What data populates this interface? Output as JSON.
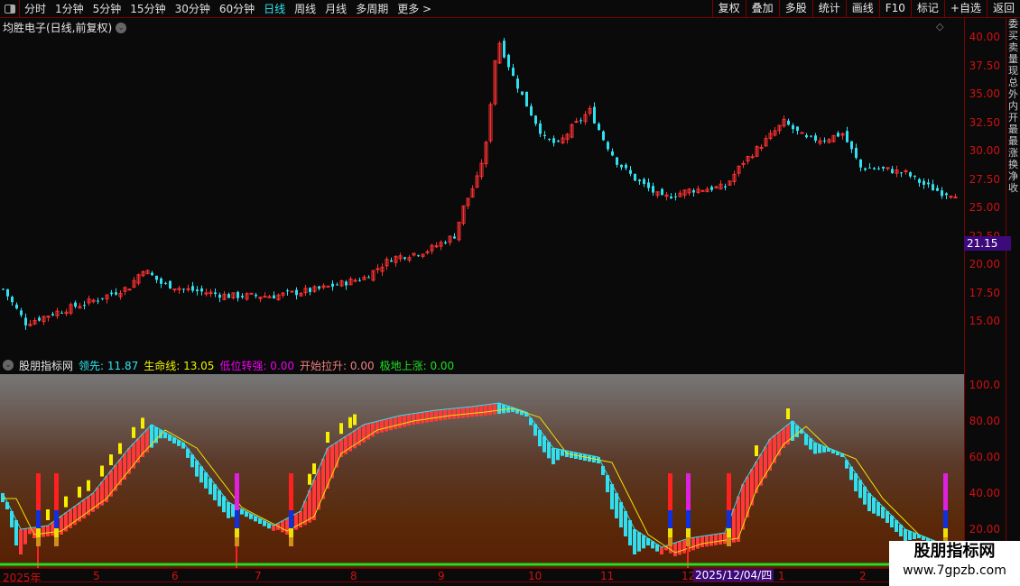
{
  "toolbar": {
    "periods": [
      "分时",
      "1分钟",
      "5分钟",
      "15分钟",
      "30分钟",
      "60分钟",
      "日线",
      "周线",
      "月线",
      "多周期",
      "更多 >"
    ],
    "active": "日线",
    "right_buttons": [
      "复权",
      "叠加",
      "多股",
      "统计",
      "画线",
      "F10",
      "标记",
      "+自选",
      "返回"
    ]
  },
  "stock": {
    "title": "均胜电子(日线,前复权)"
  },
  "price_axis": {
    "ticks": [
      "40.00",
      "37.50",
      "35.00",
      "32.50",
      "30.00",
      "27.50",
      "25.00",
      "22.50",
      "20.00",
      "17.50",
      "15.00"
    ],
    "current_price": "21.15"
  },
  "indicator": {
    "name": "股朋指标网",
    "values": [
      {
        "label": "领先: 11.87",
        "color": "#2ee6f2"
      },
      {
        "label": "生命线: 13.05",
        "color": "#f2f200"
      },
      {
        "label": "低位转强: 0.00",
        "color": "#f000f0"
      },
      {
        "label": "开始拉升: 0.00",
        "color": "#f08080"
      },
      {
        "label": "极地上涨: 0.00",
        "color": "#20e020"
      }
    ],
    "axis_ticks": [
      "100.0",
      "80.00",
      "60.00",
      "40.00",
      "20.00"
    ]
  },
  "time_axis": {
    "labels": [
      "2025年",
      "5",
      "6",
      "7",
      "8",
      "9",
      "10",
      "11",
      "12",
      "1",
      "2"
    ],
    "current_date": "2025/12/04/四"
  },
  "watermark": {
    "title": "股朋指标网",
    "url": "www.7gpzb.com"
  },
  "chart_data": {
    "type": "candlestick",
    "price_keypoints": [
      [
        0,
        17.8
      ],
      [
        5,
        14.8
      ],
      [
        12,
        15.8
      ],
      [
        20,
        16.8
      ],
      [
        28,
        18
      ],
      [
        31,
        19.6
      ],
      [
        35,
        18.3
      ],
      [
        40,
        17.8
      ],
      [
        50,
        17.2
      ],
      [
        60,
        17.2
      ],
      [
        70,
        17.8
      ],
      [
        80,
        18.8
      ],
      [
        86,
        20.5
      ],
      [
        94,
        21.2
      ],
      [
        100,
        22.5
      ],
      [
        102,
        25
      ],
      [
        105,
        27.5
      ],
      [
        107,
        30.5
      ],
      [
        109,
        38
      ],
      [
        110,
        39.5
      ],
      [
        113,
        36.5
      ],
      [
        116,
        34
      ],
      [
        120,
        31
      ],
      [
        123,
        30.5
      ],
      [
        126,
        32
      ],
      [
        130,
        33.5
      ],
      [
        133,
        31
      ],
      [
        136,
        29
      ],
      [
        140,
        27.5
      ],
      [
        146,
        25.8
      ],
      [
        152,
        26.5
      ],
      [
        160,
        26.8
      ],
      [
        164,
        29
      ],
      [
        168,
        30.5
      ],
      [
        173,
        32.5
      ],
      [
        178,
        31
      ],
      [
        182,
        31
      ],
      [
        186,
        31.5
      ],
      [
        190,
        28.5
      ],
      [
        196,
        28.3
      ],
      [
        200,
        28
      ],
      [
        204,
        27
      ],
      [
        208,
        26.3
      ],
      [
        211,
        26.2
      ]
    ],
    "indicator_keypoints": [
      [
        0,
        40
      ],
      [
        4,
        20
      ],
      [
        10,
        22
      ],
      [
        20,
        40
      ],
      [
        28,
        65
      ],
      [
        33,
        78
      ],
      [
        40,
        68
      ],
      [
        50,
        35
      ],
      [
        60,
        22
      ],
      [
        66,
        30
      ],
      [
        72,
        65
      ],
      [
        80,
        78
      ],
      [
        88,
        83
      ],
      [
        96,
        86
      ],
      [
        104,
        88
      ],
      [
        110,
        90
      ],
      [
        116,
        85
      ],
      [
        122,
        65
      ],
      [
        132,
        60
      ],
      [
        140,
        20
      ],
      [
        146,
        10
      ],
      [
        152,
        15
      ],
      [
        160,
        18
      ],
      [
        164,
        45
      ],
      [
        170,
        70
      ],
      [
        175,
        80
      ],
      [
        180,
        68
      ],
      [
        186,
        62
      ],
      [
        192,
        40
      ],
      [
        200,
        20
      ],
      [
        208,
        12
      ]
    ],
    "signal_bars": [
      8,
      12,
      52,
      64,
      148,
      152,
      161,
      209
    ]
  }
}
